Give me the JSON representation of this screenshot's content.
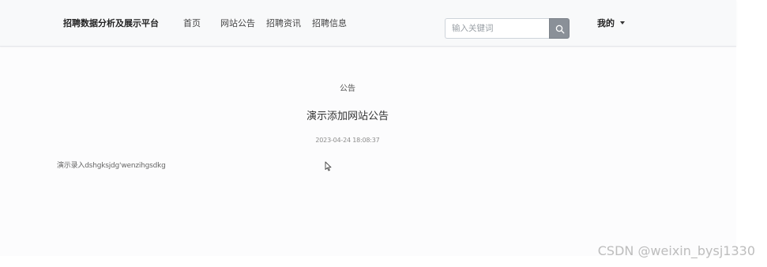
{
  "navbar": {
    "brand": "招聘数据分析及展示平台",
    "items": [
      {
        "label": "首页"
      },
      {
        "label": "网站公告"
      },
      {
        "label": "招聘资讯"
      },
      {
        "label": "招聘信息"
      }
    ],
    "search": {
      "placeholder": "输入关键词",
      "value": "",
      "button_icon": "search-icon"
    },
    "user_menu": {
      "label": "我的",
      "icon": "caret-down-icon"
    }
  },
  "article": {
    "category": "公告",
    "title": "演示添加网站公告",
    "date": "2023-04-24 18:08:37",
    "content": "演示录入dshgksjdg'wenzihgsdkg"
  },
  "watermark": "CSDN @weixin_bysj1330",
  "colors": {
    "navbar_bg": "#f8f9fa",
    "search_button_bg": "#8a9098",
    "page_bg": "#fcfcfd"
  }
}
